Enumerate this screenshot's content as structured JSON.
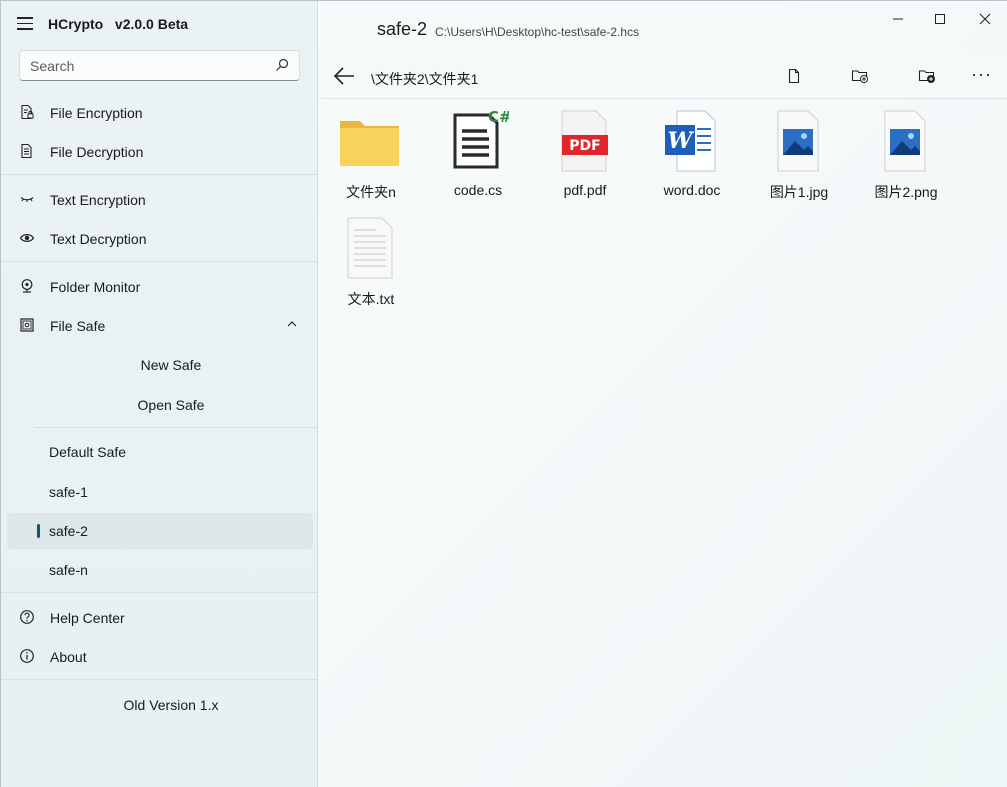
{
  "app": {
    "name": "HCrypto",
    "version": "v2.0.0 Beta"
  },
  "search": {
    "placeholder": "Search",
    "value": ""
  },
  "nav": {
    "file_encryption": "File Encryption",
    "file_decryption": "File Decryption",
    "text_encryption": "Text Encryption",
    "text_decryption": "Text Decryption",
    "folder_monitor": "Folder Monitor",
    "file_safe": "File Safe",
    "new_safe": "New Safe",
    "open_safe": "Open Safe",
    "safes": [
      "Default Safe",
      "safe-1",
      "safe-2",
      "safe-n"
    ],
    "selected_safe": "safe-2",
    "help_center": "Help Center",
    "about": "About",
    "old_version": "Old Version 1.x"
  },
  "window": {
    "title": "safe-2",
    "path": "C:\\Users\\H\\Desktop\\hc-test\\safe-2.hcs"
  },
  "toolbar": {
    "current_path": "\\文件夹2\\文件夹1",
    "more_label": "···"
  },
  "files": [
    {
      "name": "文件夹n",
      "type": "folder"
    },
    {
      "name": "code.cs",
      "type": "csharp"
    },
    {
      "name": "pdf.pdf",
      "type": "pdf"
    },
    {
      "name": "word.doc",
      "type": "word"
    },
    {
      "name": "图片1.jpg",
      "type": "image"
    },
    {
      "name": "图片2.png",
      "type": "image"
    },
    {
      "name": "文本.txt",
      "type": "text"
    }
  ],
  "colors": {
    "accent": "#0f5a6a",
    "folder": "#f6c94a",
    "pdf": "#e0262a",
    "word": "#1e5eb8",
    "csharp": "#2e8b3a",
    "image": "#2a6fc4"
  },
  "icons": {
    "file_badge": "C#",
    "pdf_badge": "PDF",
    "word_badge": "W"
  }
}
